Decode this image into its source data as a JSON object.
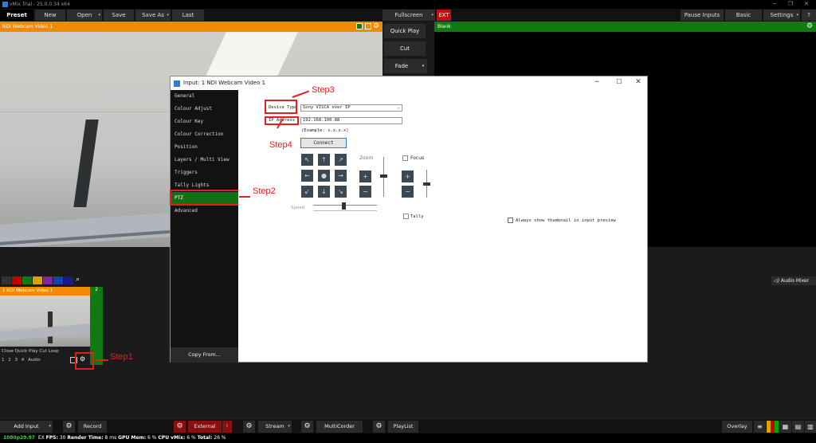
{
  "app": {
    "title": "vMix Trial - 25.0.0.34 x64"
  },
  "toolbar": {
    "preset": "Preset",
    "new": "New",
    "open": "Open",
    "save": "Save",
    "save_as": "Save As",
    "last": "Last",
    "fullscreen": "Fullscreen",
    "ext": "EXT",
    "pause_inputs": "Pause Inputs",
    "basic": "Basic",
    "settings": "Settings",
    "help": "?"
  },
  "preview": {
    "title": "NDI Webcam Video 1"
  },
  "program": {
    "title": "Blank"
  },
  "transitions": {
    "quick_play": "Quick Play",
    "cut": "Cut",
    "fade": "Fade"
  },
  "dialog": {
    "title": "Input: 1 NDI Webcam Video 1",
    "nav": [
      "General",
      "Colour Adjust",
      "Colour Key",
      "Colour Correction",
      "Position",
      "Layers / Multi View",
      "Triggers",
      "Tally Lights",
      "PTZ",
      "Advanced"
    ],
    "copy_from": "Copy From...",
    "device_type_label": "Device Type",
    "device_type_value": "Sony VISCA over IP",
    "ip_label": "IP Address",
    "ip_value": "192.168.100.88",
    "example": "(Example: x.x.x.x)",
    "connect": "Connect",
    "zoom": "Zoom",
    "focus": "Focus",
    "speed": "Speed",
    "tally": "Tally",
    "thumbnail": "Always show thumbnail in input preview",
    "pad_icons": [
      "↖",
      "↑",
      "↗",
      "←",
      "●",
      "→",
      "↙",
      "↓",
      "↘"
    ]
  },
  "annotations": {
    "step1": "Step1",
    "step2": "Step2",
    "step3": "Step3",
    "step4": "Step4"
  },
  "audio_mixer": "Audio Mixer",
  "input_box": {
    "title": "1  NDI Webcam Video 1",
    "number2": "2",
    "controls": [
      "Close",
      "Quick Play",
      "Cut",
      "Loop"
    ],
    "numbers": [
      "1",
      "2",
      "3",
      "4"
    ],
    "audio": "Audio"
  },
  "color_swatches": [
    "#333333",
    "#c00000",
    "#0f7a0f",
    "#d9a400",
    "#7a2a9a",
    "#1a3fb0",
    "#1a1a8a"
  ],
  "bottom": {
    "add_input": "Add Input",
    "record": "Record",
    "external": "External",
    "stream": "Stream",
    "multicorder": "MultiCorder",
    "playlist": "PlayList",
    "overlay": "Overlay"
  },
  "status": {
    "format": "1080p29.97",
    "ex": "EX",
    "fps_label": "FPS:",
    "fps": "30",
    "render_label": "Render Time:",
    "render": "8 ms",
    "gpu_label": "GPU Mem:",
    "gpu": "6 %",
    "cpu_label": "CPU vMix:",
    "cpu": "6 %",
    "total_label": "Total:",
    "total": "26 %"
  }
}
